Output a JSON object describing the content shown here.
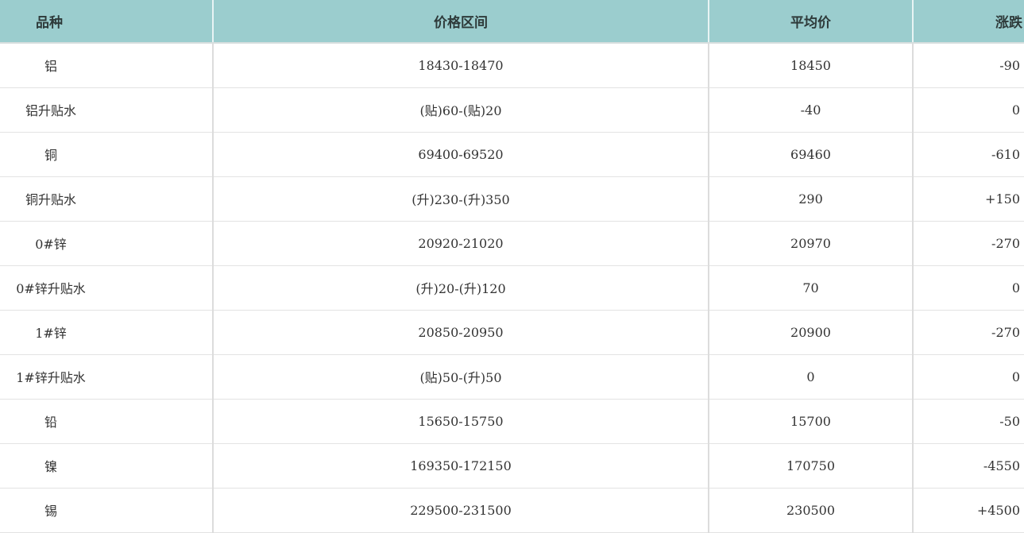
{
  "headers": {
    "variety": "品种",
    "price_range": "价格区间",
    "average": "平均价",
    "change": "涨跌"
  },
  "rows": [
    {
      "variety": "铝",
      "range": "18430-18470",
      "avg": "18450",
      "change": "-90"
    },
    {
      "variety": "铝升贴水",
      "range": "(贴)60-(贴)20",
      "avg": "-40",
      "change": "0"
    },
    {
      "variety": "铜",
      "range": "69400-69520",
      "avg": "69460",
      "change": "-610"
    },
    {
      "variety": "铜升贴水",
      "range": "(升)230-(升)350",
      "avg": "290",
      "change": "+150"
    },
    {
      "variety": "0#锌",
      "range": "20920-21020",
      "avg": "20970",
      "change": "-270"
    },
    {
      "variety": "0#锌升贴水",
      "range": "(升)20-(升)120",
      "avg": "70",
      "change": "0"
    },
    {
      "variety": "1#锌",
      "range": "20850-20950",
      "avg": "20900",
      "change": "-270"
    },
    {
      "variety": "1#锌升贴水",
      "range": "(贴)50-(升)50",
      "avg": "0",
      "change": "0"
    },
    {
      "variety": "铅",
      "range": "15650-15750",
      "avg": "15700",
      "change": "-50"
    },
    {
      "variety": "镍",
      "range": "169350-172150",
      "avg": "170750",
      "change": "-4550"
    },
    {
      "variety": "锡",
      "range": "229500-231500",
      "avg": "230500",
      "change": "+4500"
    }
  ],
  "colors": {
    "header_bg": "#9bcdce",
    "text": "#333333",
    "grid": "#dcdcdc"
  }
}
